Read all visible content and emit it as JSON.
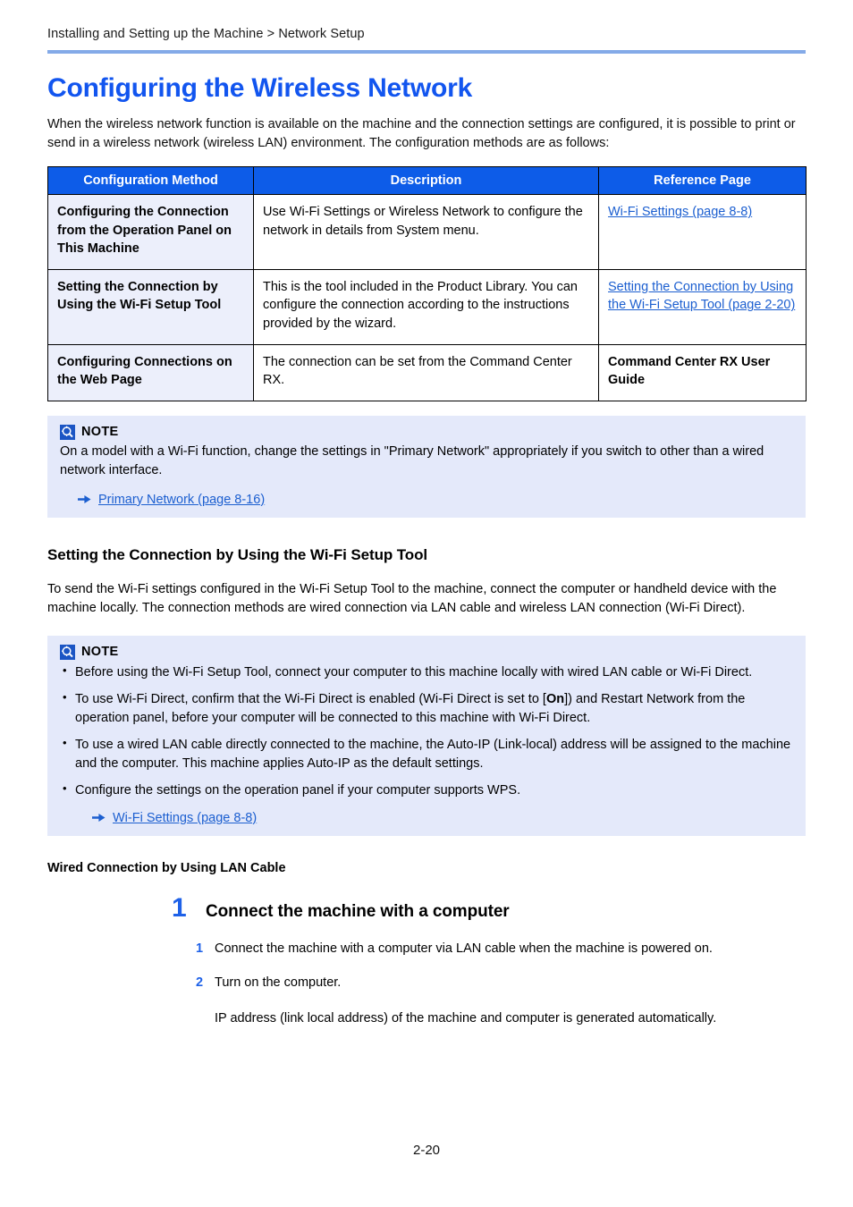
{
  "header": {
    "breadcrumb": "Installing and Setting up the Machine > Network Setup",
    "rule_color": "#84aae8"
  },
  "title": "Configuring the Wireless Network",
  "intro": "When the wireless network function is available on the machine and the connection settings are configured, it is possible to print or send in a wireless network (wireless LAN) environment. The configuration methods are as follows:",
  "table": {
    "header_bg": "#0d5ce8",
    "first_col_bg": "#eceffb",
    "columns": [
      "Configuration Method",
      "Description",
      "Reference Page"
    ],
    "rows": [
      {
        "method": "Configuring the Connection from the Operation Panel on This Machine",
        "description": "Use Wi-Fi Settings or Wireless Network to configure the network in details from System menu.",
        "reference": "Wi-Fi Settings (page 8-8)",
        "reference_is_link": true
      },
      {
        "method": "Setting the Connection by Using the Wi-Fi Setup Tool",
        "description": "This is the tool included in the Product Library. You can configure the connection according to the instructions provided by the wizard.",
        "reference": "Setting the Connection by Using the Wi-Fi Setup Tool (page 2-20)",
        "reference_is_link": true
      },
      {
        "method": "Configuring Connections on the Web Page",
        "description": "The connection can be set from the Command Center RX.",
        "reference": "Command Center RX User Guide",
        "reference_is_link": false
      }
    ]
  },
  "note1": {
    "icon": "note-magnifier-icon",
    "title": "NOTE",
    "body": "On a model with a Wi-Fi function, change the settings in \"Primary Network\" appropriately if you switch to other than a wired network interface.",
    "xref": "Primary Network (page 8-16)",
    "bg": "#e4e9fa"
  },
  "section": {
    "heading": "Setting the Connection by Using the Wi-Fi Setup Tool",
    "body": "To send the Wi-Fi settings configured in the Wi-Fi Setup Tool to the machine, connect the computer or handheld device with the machine locally. The connection methods are wired connection via LAN cable and wireless LAN connection (Wi-Fi Direct)."
  },
  "note2": {
    "icon": "note-magnifier-icon",
    "title": "NOTE",
    "bullets": [
      "Before using the Wi-Fi Setup Tool, connect your computer to this machine locally with wired LAN cable or Wi-Fi Direct.",
      "To use Wi-Fi Direct, confirm that the Wi-Fi Direct is enabled (Wi-Fi Direct is set to [On]) and Restart Network from the operation panel, before your computer will be connected to this machine with Wi-Fi Direct.",
      "To use a wired LAN cable directly connected to the machine, the Auto-IP (Link-local) address will be assigned to the machine and the computer. This machine applies Auto-IP as the default settings.",
      "Configure the settings on the operation panel if your computer supports WPS."
    ],
    "bullet2_pre": "To use Wi-Fi Direct, confirm that the Wi-Fi Direct is enabled (Wi-Fi Direct is set to [",
    "bullet2_bold": "On",
    "bullet2_post": "]) and Restart Network from the operation panel, before your computer will be connected to this machine with Wi-Fi Direct.",
    "xref": "Wi-Fi Settings (page 8-8)",
    "bg": "#e4e9fa"
  },
  "subheading": "Wired Connection by Using LAN Cable",
  "procedure": {
    "step_number": "1",
    "step_title": "Connect the machine with a computer",
    "substeps": [
      {
        "num": "1",
        "text": "Connect the machine with a computer via LAN cable when the machine is powered on."
      },
      {
        "num": "2",
        "text": "Turn on the computer."
      }
    ],
    "extra_text": "IP address (link local address) of the machine and computer is generated automatically."
  },
  "footer": {
    "page_number": "2-20"
  },
  "colors": {
    "title_blue": "#1255ef",
    "link_blue": "#1c5fd0",
    "step_blue": "#1e61e8",
    "table_header_blue": "#0d5ce8"
  }
}
